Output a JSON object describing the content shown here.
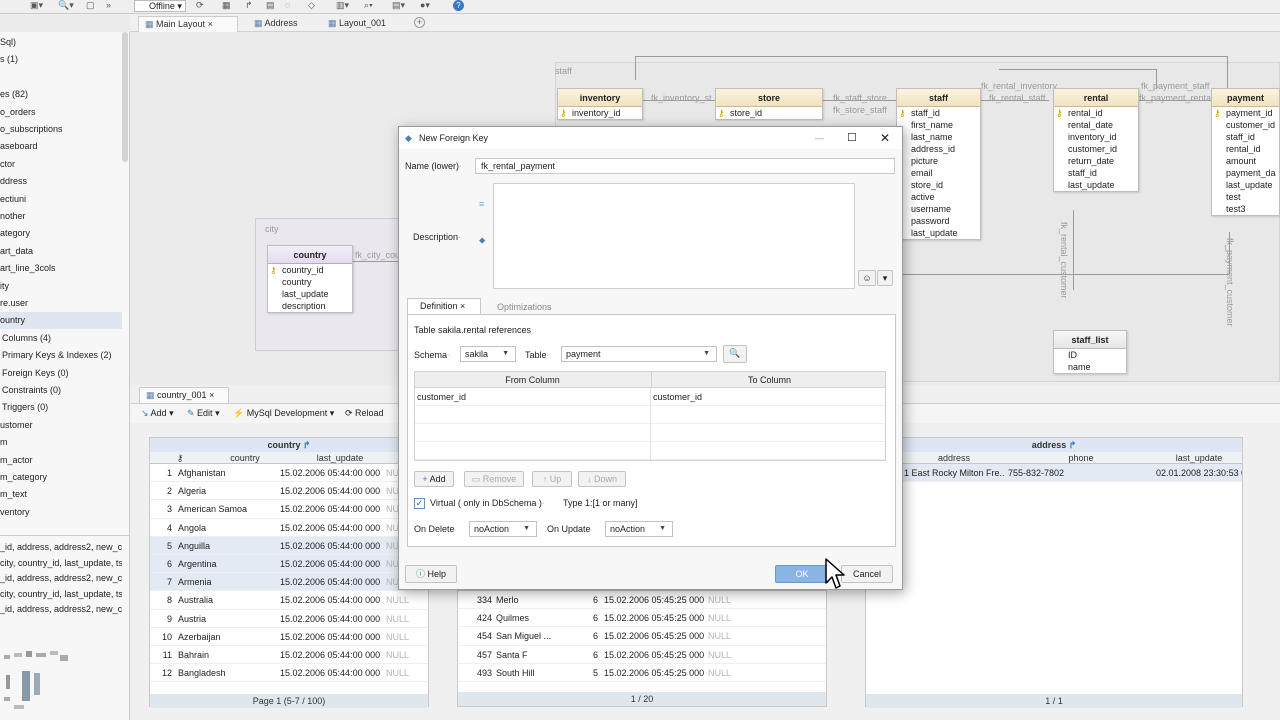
{
  "toolbar": {
    "offline_label": "Offline"
  },
  "tabs": [
    {
      "label": "Main Layout",
      "close": "×"
    },
    {
      "label": "Address"
    },
    {
      "label": "Layout_001"
    }
  ],
  "tree": {
    "items": [
      "Sql)",
      "s (1)",
      "",
      "es (82)",
      "o_orders",
      "o_subscriptions",
      "aseboard",
      "ctor",
      "ddress",
      "ectiuni",
      "nother",
      "ategory",
      "art_data",
      "art_line_3cols",
      "ity",
      "re.user",
      "ountry",
      "Columns (4)",
      "Primary Keys & Indexes (2)",
      "Foreign Keys (0)",
      "Constraints (0)",
      "Triggers (0)",
      "ustomer",
      "m",
      "m_actor",
      "m_category",
      "m_text",
      "ventory"
    ],
    "sql_lines": [
      "_id, address, address2, new_cc",
      "city, country_id, last_update, ts",
      "_id, address, address2, new_cc",
      "city, country_id, last_update, ts",
      "_id, address, address2, new_cc"
    ]
  },
  "erd": {
    "groups": {
      "staff": "staff",
      "city": "city"
    },
    "tables": {
      "inventory": {
        "name": "inventory",
        "cols": [
          "inventory_id"
        ]
      },
      "store": {
        "name": "store",
        "cols": [
          "store_id"
        ]
      },
      "staff": {
        "name": "staff",
        "cols": [
          "staff_id",
          "first_name",
          "last_name",
          "address_id",
          "picture",
          "email",
          "store_id",
          "active",
          "username",
          "password",
          "last_update"
        ]
      },
      "rental": {
        "name": "rental",
        "cols": [
          "rental_id",
          "rental_date",
          "inventory_id",
          "customer_id",
          "return_date",
          "staff_id",
          "last_update"
        ]
      },
      "payment": {
        "name": "payment",
        "cols": [
          "payment_id",
          "customer_id",
          "staff_id",
          "rental_id",
          "amount",
          "payment_da",
          "last_update",
          "test",
          "test3"
        ]
      },
      "country": {
        "name": "country",
        "cols": [
          "country_id",
          "country",
          "last_update",
          "description"
        ]
      },
      "staff_list": {
        "name": "staff_list",
        "cols": [
          "ID",
          "name"
        ]
      }
    },
    "fk_labels": {
      "inv_st": "fk_inventory_st",
      "staff_store": "fk_staff_store",
      "store_staff": "fk_store_staff",
      "rental_inventory": "fk_rental_inventory",
      "rental_staff": "fk_rental_staff",
      "payment_staff": "fk_payment_staff",
      "payment_rental": "fk_payment_rental",
      "rental_customer": "fk_rental_customer",
      "payment_customer": "fk_payment_customer",
      "city_coun": "fk_city_coun"
    }
  },
  "query_tab": {
    "label": "country_001",
    "add": "Add",
    "edit": "Edit",
    "connection": "MySql Development",
    "reload": "Reload"
  },
  "grid_country": {
    "title": "country",
    "headers": [
      "country",
      "last_update"
    ],
    "rows": [
      [
        "1",
        "Afghanistan",
        "15.02.2006 05:44:00 000",
        "NULL"
      ],
      [
        "2",
        "Algeria",
        "15.02.2006 05:44:00 000",
        "NULL"
      ],
      [
        "3",
        "American Samoa",
        "15.02.2006 05:44:00 000",
        "NULL"
      ],
      [
        "4",
        "Angola",
        "15.02.2006 05:44:00 000",
        "NULL"
      ],
      [
        "5",
        "Anguilla",
        "15.02.2006 05:44:00 000",
        "NULL"
      ],
      [
        "6",
        "Argentina",
        "15.02.2006 05:44:00 000",
        "NULL"
      ],
      [
        "7",
        "Armenia",
        "15.02.2006 05:44:00 000",
        "NULL"
      ],
      [
        "8",
        "Australia",
        "15.02.2006 05:44:00 000",
        "NULL"
      ],
      [
        "9",
        "Austria",
        "15.02.2006 05:44:00 000",
        "NULL"
      ],
      [
        "10",
        "Azerbaijan",
        "15.02.2006 05:44:00 000",
        "NULL"
      ],
      [
        "11",
        "Bahrain",
        "15.02.2006 05:44:00 000",
        "NULL"
      ],
      [
        "12",
        "Bangladesh",
        "15.02.2006 05:44:00 000",
        "NULL"
      ]
    ],
    "pager": "Page 1 (5-7 / 100)"
  },
  "grid_city": {
    "rows": [
      [
        "334",
        "Merlo",
        "6",
        "15.02.2006 05:45:25 000",
        "NULL"
      ],
      [
        "424",
        "Quilmes",
        "6",
        "15.02.2006 05:45:25 000",
        "NULL"
      ],
      [
        "454",
        "San Miguel ...",
        "6",
        "15.02.2006 05:45:25 000",
        "NULL"
      ],
      [
        "457",
        "Santa F",
        "6",
        "15.02.2006 05:45:25 000",
        "NULL"
      ],
      [
        "493",
        "South Hill",
        "5",
        "15.02.2006 05:45:25 000",
        "NULL"
      ]
    ],
    "pager": "1 / 20"
  },
  "grid_address": {
    "title": "address",
    "headers": [
      "address",
      "phone",
      "last_update"
    ],
    "row": [
      "1 East Rocky Milton Fre...",
      "755-832-7802",
      "02.01.2008 23:30:53 0"
    ],
    "pager": "1 / 1"
  },
  "dialog": {
    "title": "New Foreign Key",
    "name_label": "Name (lower)",
    "name_value": "fk_rental_payment",
    "description_label": "Description",
    "tabs": [
      "Definition",
      "Optimizations"
    ],
    "references": "Table sakila.rental references",
    "schema_label": "Schema",
    "schema_value": "sakila",
    "table_label": "Table",
    "table_value": "payment",
    "col_headers": [
      "From Column",
      "To Column"
    ],
    "mapping": [
      [
        "customer_id",
        "customer_id"
      ]
    ],
    "buttons": {
      "add": "Add",
      "remove": "Remove",
      "up": "Up",
      "down": "Down"
    },
    "virtual_label": "Virtual ( only in DbSchema )",
    "virtual_checked": true,
    "type_label": "Type 1:[1 or many]",
    "on_delete_label": "On Delete",
    "on_delete_value": "noAction",
    "on_update_label": "On Update",
    "on_update_value": "noAction",
    "help": "Help",
    "ok": "OK",
    "cancel": "Cancel"
  }
}
